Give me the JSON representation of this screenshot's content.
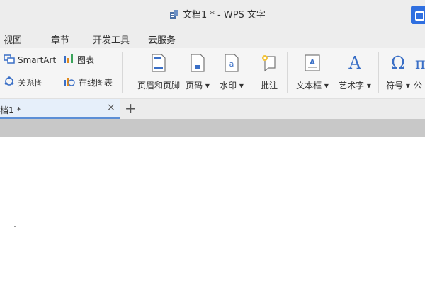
{
  "window": {
    "title": "文档1 * - WPS 文字"
  },
  "menu": {
    "items": [
      "视图",
      "章节",
      "开发工具",
      "云服务"
    ]
  },
  "ribbon": {
    "smartart_label": "SmartArt",
    "chart_label": "图表",
    "relation_label": "关系图",
    "online_chart_label": "在线图表",
    "header_footer_label": "页眉和页脚",
    "page_number_label": "页码",
    "watermark_label": "水印",
    "comment_label": "批注",
    "textbox_label": "文本框",
    "wordart_label": "艺术字",
    "symbol_label": "符号",
    "formula_label_partial": "公"
  },
  "tabs": {
    "active_label": "档1 *",
    "close_glyph": "×",
    "new_tab_glyph": "+"
  },
  "colors": {
    "accent_blue": "#2f6fe0",
    "tab_underline": "#5b8ed6",
    "icon_blue": "#3a6fc6"
  }
}
